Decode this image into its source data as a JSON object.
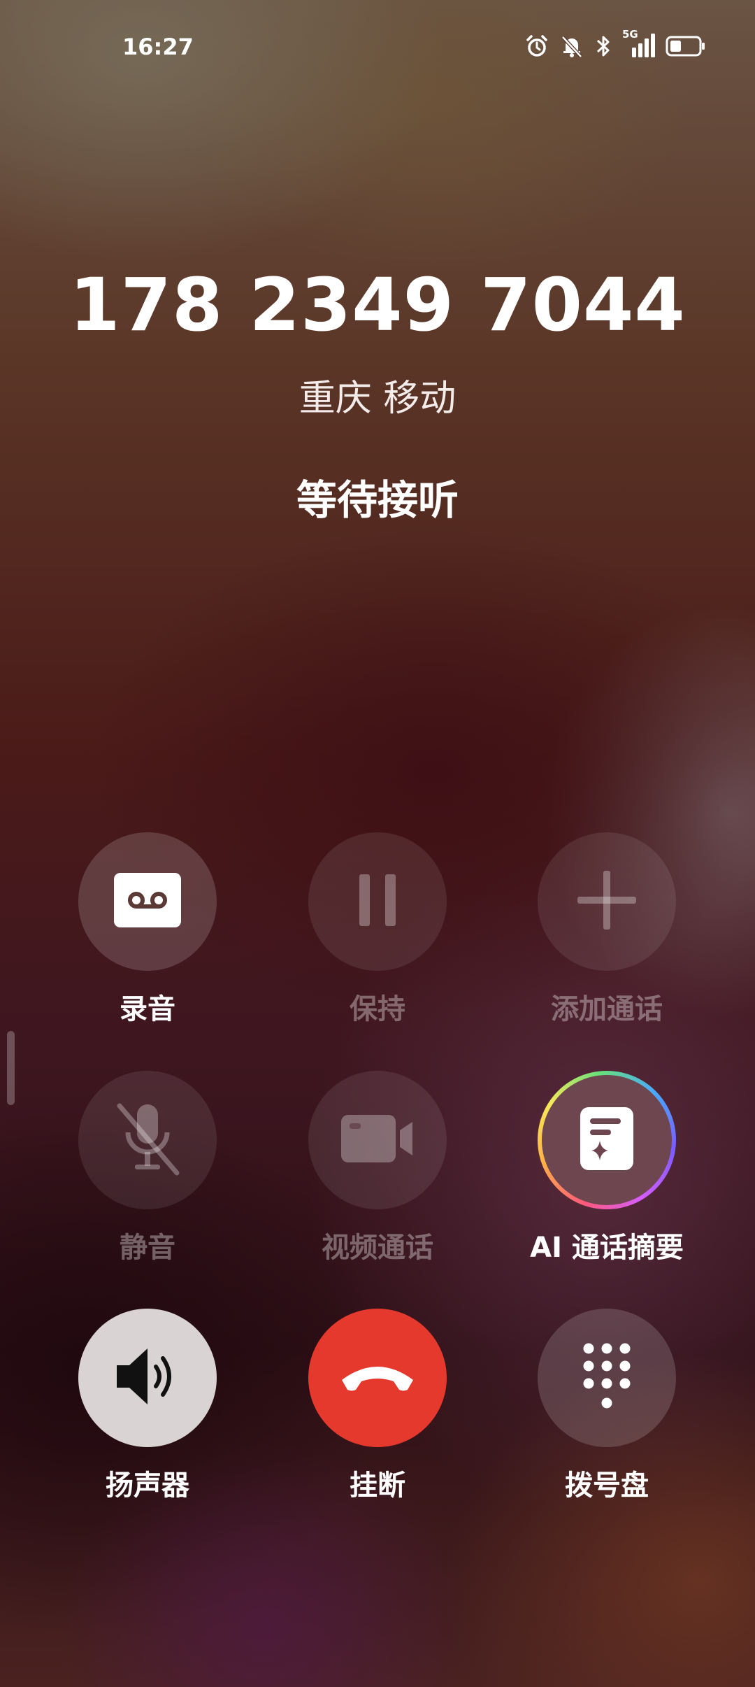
{
  "status_bar": {
    "time": "16:27",
    "network": "5G",
    "icons": [
      "alarm-icon",
      "mute-bell-icon",
      "bluetooth-icon",
      "signal-icon",
      "battery-icon"
    ]
  },
  "call": {
    "number": "178 2349 7044",
    "location": "重庆 移动",
    "state": "等待接听"
  },
  "actions": {
    "record": {
      "label": "录音",
      "enabled": true
    },
    "hold": {
      "label": "保持",
      "enabled": false
    },
    "add_call": {
      "label": "添加通话",
      "enabled": false
    },
    "mute": {
      "label": "静音",
      "enabled": false
    },
    "video_call": {
      "label": "视频通话",
      "enabled": false
    },
    "ai_summary": {
      "label": "AI 通话摘要",
      "enabled": true
    },
    "speaker": {
      "label": "扬声器",
      "enabled": true
    },
    "hang_up": {
      "label": "挂断",
      "enabled": true
    },
    "keypad": {
      "label": "拨号盘",
      "enabled": true
    }
  },
  "colors": {
    "hang_up": "#e6392e",
    "speaker_bg": "#d9d3d3"
  }
}
